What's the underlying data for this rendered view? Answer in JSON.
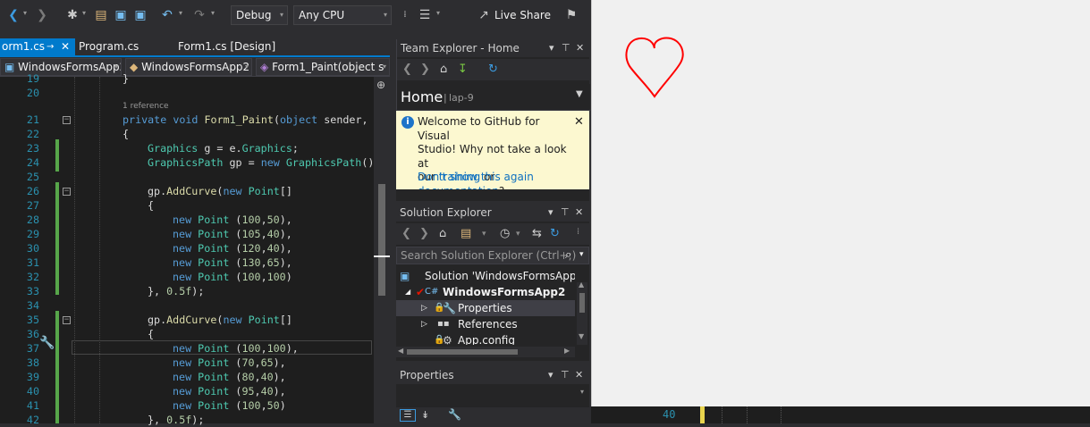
{
  "toolbar": {
    "config": "Debug",
    "platform": "Any CPU",
    "live_share": "Live Share"
  },
  "tabs": [
    {
      "label": "orm1.cs"
    },
    {
      "label": "Program.cs"
    },
    {
      "label": "Form1.cs [Design]"
    }
  ],
  "navbar": {
    "project": "WindowsFormsApp2",
    "class": "WindowsFormsApp2",
    "member": "Form1_Paint(object s"
  },
  "editor": {
    "codelens": "1 reference",
    "lines": [
      {
        "n": "19",
        "t": "}"
      },
      {
        "n": "20",
        "t": ""
      },
      {
        "n": "21",
        "t": "private void Form1_Paint(object sender,"
      },
      {
        "n": "22",
        "t": "{"
      },
      {
        "n": "23",
        "t": "Graphics g = e.Graphics;"
      },
      {
        "n": "24",
        "t": "GraphicsPath gp = new GraphicsPath()"
      },
      {
        "n": "25",
        "t": ""
      },
      {
        "n": "26",
        "t": "gp.AddCurve(new Point[]"
      },
      {
        "n": "27",
        "t": "{"
      },
      {
        "n": "28",
        "t": "new Point (100,50),"
      },
      {
        "n": "29",
        "t": "new Point (105,40),"
      },
      {
        "n": "30",
        "t": "new Point (120,40),"
      },
      {
        "n": "31",
        "t": "new Point (130,65),"
      },
      {
        "n": "32",
        "t": "new Point (100,100)"
      },
      {
        "n": "33",
        "t": "}, 0.5f);"
      },
      {
        "n": "34",
        "t": ""
      },
      {
        "n": "35",
        "t": "gp.AddCurve(new Point[]"
      },
      {
        "n": "36",
        "t": "{"
      },
      {
        "n": "37",
        "t": "new Point (100,100),"
      },
      {
        "n": "38",
        "t": "new Point (70,65),"
      },
      {
        "n": "39",
        "t": "new Point (80,40),"
      },
      {
        "n": "40",
        "t": "new Point (95,40),"
      },
      {
        "n": "41",
        "t": "new Point (100,50)"
      },
      {
        "n": "42",
        "t": "}, 0.5f);"
      }
    ]
  },
  "team_explorer": {
    "title": "Team Explorer - Home",
    "home": "Home",
    "server": "lap-9",
    "info_line1": "Welcome to GitHub for Visual",
    "info_line2": "Studio! Why not take a look at",
    "info_our": "our",
    "info_training": "training",
    "info_or": "or",
    "info_documentation": "documentation",
    "info_q": "?",
    "info_dismiss": "Don't show this again"
  },
  "solution_explorer": {
    "title": "Solution Explorer",
    "search_placeholder": "Search Solution Explorer (Ctrl+;)",
    "solution": "Solution 'WindowsFormsApp2'",
    "project": "WindowsFormsApp2",
    "properties": "Properties",
    "references": "References",
    "appconfig": "App.config"
  },
  "properties_panel": {
    "title": "Properties"
  },
  "bottom_strip": {
    "line": "40"
  },
  "colors": {
    "accent": "#007acc",
    "heart": "#ff0000"
  }
}
